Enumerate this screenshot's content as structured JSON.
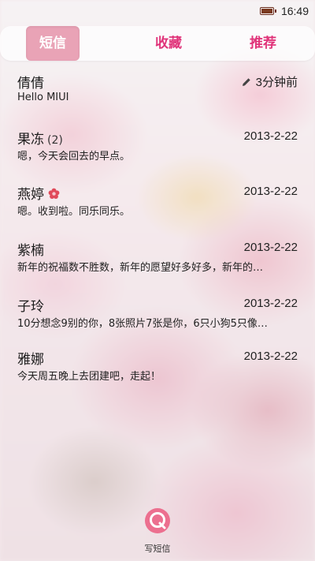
{
  "status_bar": {
    "time": "16:49",
    "battery_icon": "battery-icon"
  },
  "tabs": [
    {
      "label": "短信",
      "active": true
    },
    {
      "label": "收藏",
      "active": false
    },
    {
      "label": "推荐",
      "active": false
    }
  ],
  "colors": {
    "accent": "#e0347a",
    "active_tab_bg": "#e9a3b6"
  },
  "conversations": [
    {
      "name": "倩倩",
      "count": "",
      "badge": "",
      "time": "3分钟前",
      "draft": true,
      "preview": "Hello MIUI"
    },
    {
      "name": "果冻",
      "count": "(2)",
      "badge": "",
      "time": "2013-2-22",
      "draft": false,
      "preview": "嗯，今天会回去的早点。"
    },
    {
      "name": "燕婷",
      "count": "",
      "badge": "flower-icon",
      "time": "2013-2-22",
      "draft": false,
      "preview": "嗯。收到啦。同乐同乐。"
    },
    {
      "name": "紫楠",
      "count": "",
      "badge": "",
      "time": "2013-2-22",
      "draft": false,
      "preview": "新年的祝福数不胜数，新年的愿望好多好多，新年的…"
    },
    {
      "name": "子玲",
      "count": "",
      "badge": "",
      "time": "2013-2-22",
      "draft": false,
      "preview": "10分想念9别的你，8张照片7张是你，6只小狗5只像…"
    },
    {
      "name": "雅娜",
      "count": "",
      "badge": "",
      "time": "2013-2-22",
      "draft": false,
      "preview": "今天周五晚上去团建吧，走起！"
    }
  ],
  "compose": {
    "label": "写短信",
    "icon": "compose-message-icon"
  }
}
